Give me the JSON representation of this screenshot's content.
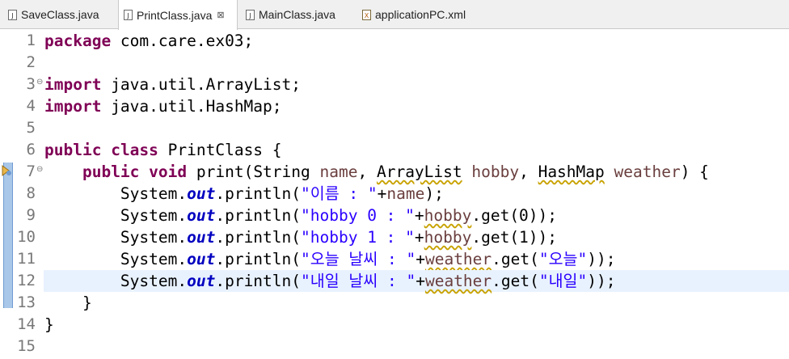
{
  "tabs": [
    {
      "label": "SaveClass.java",
      "icon": "java-file-icon",
      "active": false
    },
    {
      "label": "PrintClass.java",
      "icon": "java-file-icon",
      "active": true,
      "close": "⊠"
    },
    {
      "label": "MainClass.java",
      "icon": "java-file-icon",
      "active": false
    },
    {
      "label": "applicationPC.xml",
      "icon": "xml-file-icon",
      "active": false
    }
  ],
  "editor": {
    "line_numbers": [
      "1",
      "2",
      "3",
      "4",
      "5",
      "6",
      "7",
      "8",
      "9",
      "10",
      "11",
      "12",
      "13",
      "14",
      "15"
    ],
    "current_line": 12,
    "colors": {
      "keyword": "#7f0055",
      "string": "#2a00ff",
      "field": "#0000c0",
      "current_line": "#e8f2fe"
    },
    "lines": [
      [
        {
          "t": "package",
          "c": "kw"
        },
        {
          "t": " com.care.ex03;"
        }
      ],
      [],
      [
        {
          "t": "import",
          "c": "kw"
        },
        {
          "t": " java.util.ArrayList;"
        }
      ],
      [
        {
          "t": "import",
          "c": "kw"
        },
        {
          "t": " java.util.HashMap;"
        }
      ],
      [],
      [
        {
          "t": "public",
          "c": "kw"
        },
        {
          "t": " "
        },
        {
          "t": "class",
          "c": "kw"
        },
        {
          "t": " PrintClass {"
        }
      ],
      [
        {
          "t": "    "
        },
        {
          "t": "public",
          "c": "kw"
        },
        {
          "t": " "
        },
        {
          "t": "void",
          "c": "kw"
        },
        {
          "t": " print(String "
        },
        {
          "t": "name",
          "c": "param"
        },
        {
          "t": ", "
        },
        {
          "t": "ArrayList",
          "c": "warn"
        },
        {
          "t": " "
        },
        {
          "t": "hobby",
          "c": "param"
        },
        {
          "t": ", "
        },
        {
          "t": "HashMap",
          "c": "warn"
        },
        {
          "t": " "
        },
        {
          "t": "weather",
          "c": "param"
        },
        {
          "t": ") {"
        }
      ],
      [
        {
          "t": "        System."
        },
        {
          "t": "out",
          "c": "fld"
        },
        {
          "t": ".println("
        },
        {
          "t": "\"이름 : \"",
          "c": "str"
        },
        {
          "t": "+"
        },
        {
          "t": "name",
          "c": "param"
        },
        {
          "t": ");"
        }
      ],
      [
        {
          "t": "        System."
        },
        {
          "t": "out",
          "c": "fld"
        },
        {
          "t": ".println("
        },
        {
          "t": "\"hobby 0 : \"",
          "c": "str"
        },
        {
          "t": "+"
        },
        {
          "t": "hobby",
          "c": "param warn"
        },
        {
          "t": ".get(0));"
        }
      ],
      [
        {
          "t": "        System."
        },
        {
          "t": "out",
          "c": "fld"
        },
        {
          "t": ".println("
        },
        {
          "t": "\"hobby 1 : \"",
          "c": "str"
        },
        {
          "t": "+"
        },
        {
          "t": "hobby",
          "c": "param warn"
        },
        {
          "t": ".get(1));"
        }
      ],
      [
        {
          "t": "        System."
        },
        {
          "t": "out",
          "c": "fld"
        },
        {
          "t": ".println("
        },
        {
          "t": "\"오늘 날씨 : \"",
          "c": "str"
        },
        {
          "t": "+"
        },
        {
          "t": "weather",
          "c": "param warn"
        },
        {
          "t": ".get("
        },
        {
          "t": "\"오늘\"",
          "c": "str"
        },
        {
          "t": "));"
        }
      ],
      [
        {
          "t": "        System."
        },
        {
          "t": "out",
          "c": "fld"
        },
        {
          "t": ".println("
        },
        {
          "t": "\"내일 날씨 : \"",
          "c": "str"
        },
        {
          "t": "+"
        },
        {
          "t": "weather",
          "c": "param warn"
        },
        {
          "t": ".get("
        },
        {
          "t": "\"내일\"",
          "c": "str"
        },
        {
          "t": "));"
        }
      ],
      [
        {
          "t": "    }"
        }
      ],
      [
        {
          "t": "}"
        }
      ],
      []
    ],
    "fold_markers": {
      "3": "⊖",
      "7": "⊖"
    },
    "warning_marker_line": 7
  }
}
